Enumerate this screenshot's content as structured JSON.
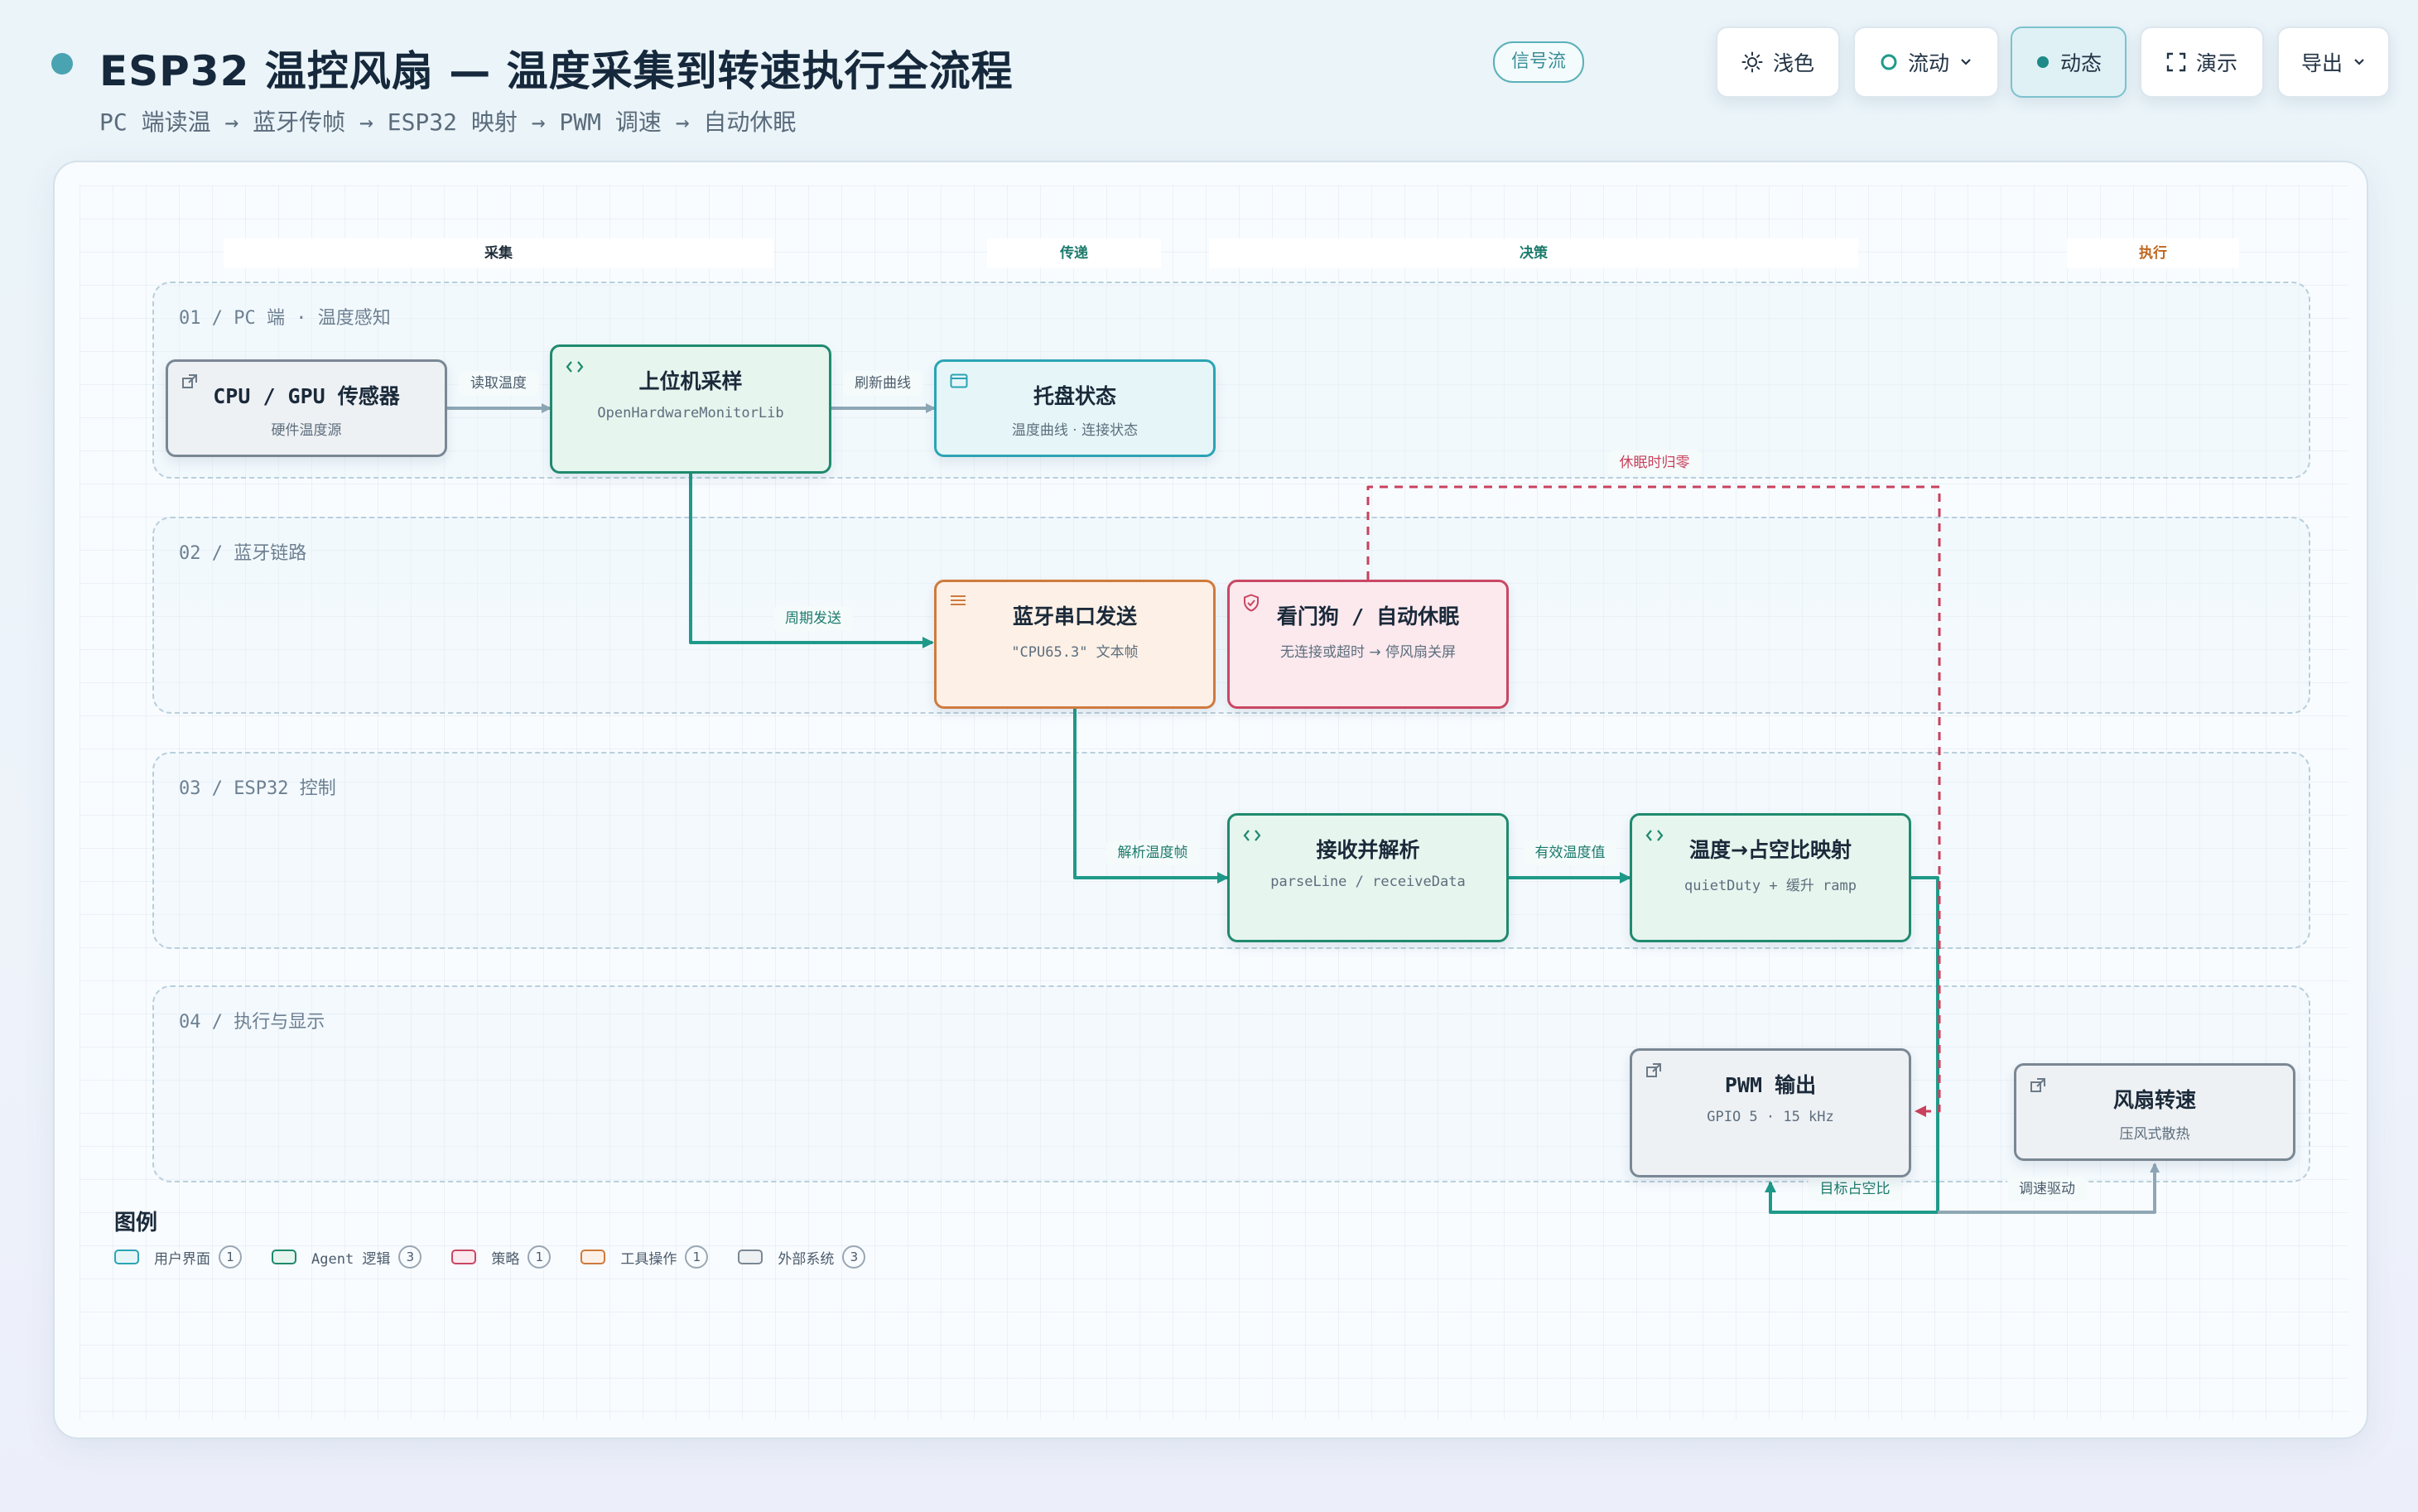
{
  "header": {
    "title": "ESP32 温控风扇 — 温度采集到转速执行全流程",
    "subtitle": "PC 端读温 → 蓝牙传帧 → ESP32 映射 → PWM 调速 → 自动休眠",
    "mode_pill": "信号流"
  },
  "toolbar": {
    "theme_label": "浅色",
    "flow_label": "流动",
    "animate_label": "动态",
    "present_label": "演示",
    "export_label": "导出"
  },
  "stages": [
    {
      "label": "采集",
      "color": "#2b3a4a"
    },
    {
      "label": "传递",
      "color": "#1c7a6c"
    },
    {
      "label": "决策",
      "color": "#1c7a6c"
    },
    {
      "label": "执行",
      "color": "#c0661e"
    }
  ],
  "lanes": [
    {
      "label": "01 / PC 端 · 温度感知"
    },
    {
      "label": "02 / 蓝牙链路"
    },
    {
      "label": "03 / ESP32 控制"
    },
    {
      "label": "04 / 执行与显示"
    }
  ],
  "nodes": {
    "sensor": {
      "title": "CPU / GPU 传感器",
      "sub": "硬件温度源",
      "icon": "external-icon"
    },
    "host": {
      "title": "上位机采样",
      "sub": "OpenHardwareMonitorLib",
      "icon": "code-icon"
    },
    "tray": {
      "title": "托盘状态",
      "sub": "温度曲线 · 连接状态",
      "icon": "window-icon"
    },
    "bt": {
      "title": "蓝牙串口发送",
      "sub": "\"CPU65.3\" 文本帧",
      "icon": "menu-icon"
    },
    "watchdog": {
      "title": "看门狗 / 自动休眠",
      "sub": "无连接或超时 → 停风扇关屏",
      "icon": "shield-icon"
    },
    "parse": {
      "title": "接收并解析",
      "sub": "parseLine / receiveData",
      "icon": "code-icon"
    },
    "map": {
      "title": "温度→占空比映射",
      "sub": "quietDuty + 缓升 ramp",
      "icon": "code-icon"
    },
    "pwm": {
      "title": "PWM 输出",
      "sub": "GPIO 5 · 15 kHz",
      "icon": "external-icon"
    },
    "fan": {
      "title": "风扇转速",
      "sub": "压风式散热",
      "icon": "external-icon"
    }
  },
  "edges": {
    "read_temp": "读取温度",
    "refresh_curve": "刷新曲线",
    "periodic_send": "周期发送",
    "sleep_zero": "休眠时归零",
    "parse_temp_frame": "解析温度帧",
    "valid_temp": "有效温度值",
    "target_duty": "目标占空比",
    "speed_drive": "调速驱动"
  },
  "legend": {
    "title": "图例",
    "items": [
      {
        "label": "用户界面",
        "count": "1",
        "color": "#2aa4b4",
        "fill": "#e6f6f8"
      },
      {
        "label": "Agent 逻辑",
        "count": "3",
        "color": "#1f8a6e",
        "fill": "#e6f5ee"
      },
      {
        "label": "策略",
        "count": "1",
        "color": "#c94763",
        "fill": "#fbe9ee"
      },
      {
        "label": "工具操作",
        "count": "1",
        "color": "#cf7a3e",
        "fill": "#fdf0e6"
      },
      {
        "label": "外部系统",
        "count": "3",
        "color": "#7a8794",
        "fill": "#eef1f4"
      }
    ]
  },
  "colors": {
    "teal": "#1f9a8a",
    "red": "#c9415c",
    "gray_edge": "#8fa7b5"
  }
}
